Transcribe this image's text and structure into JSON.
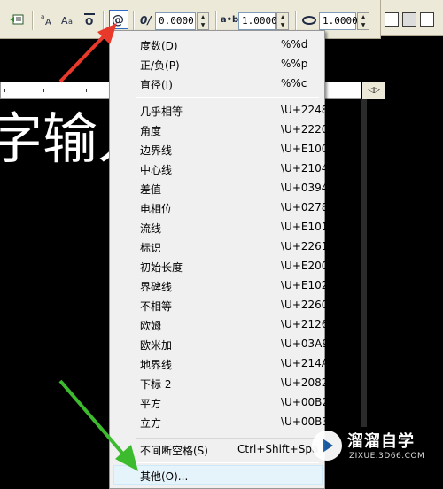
{
  "toolbar": {
    "icons": [
      "text-insert-icon",
      "stack-fraction-icon",
      "match-text-icon",
      "overline-icon",
      "symbol-icon"
    ],
    "oblique": {
      "value": "0.0000"
    },
    "tracking": {
      "label": "a•b",
      "value": "1.0000"
    },
    "width_factor": {
      "value": "1.0000"
    }
  },
  "ruler": {
    "arrows": "◁▷"
  },
  "editor": {
    "text": "字输入"
  },
  "menu": {
    "group1": [
      {
        "label": "度数(D)",
        "code": "%%d"
      },
      {
        "label": "正/负(P)",
        "code": "%%p"
      },
      {
        "label": "直径(I)",
        "code": "%%c"
      }
    ],
    "group2": [
      {
        "label": "几乎相等",
        "code": "\\U+2248"
      },
      {
        "label": "角度",
        "code": "\\U+2220"
      },
      {
        "label": "边界线",
        "code": "\\U+E100"
      },
      {
        "label": "中心线",
        "code": "\\U+2104"
      },
      {
        "label": "差值",
        "code": "\\U+0394"
      },
      {
        "label": "电相位",
        "code": "\\U+0278"
      },
      {
        "label": "流线",
        "code": "\\U+E101"
      },
      {
        "label": "标识",
        "code": "\\U+2261"
      },
      {
        "label": "初始长度",
        "code": "\\U+E200"
      },
      {
        "label": "界碑线",
        "code": "\\U+E102"
      },
      {
        "label": "不相等",
        "code": "\\U+2260"
      },
      {
        "label": "欧姆",
        "code": "\\U+2126"
      },
      {
        "label": "欧米加",
        "code": "\\U+03A9"
      },
      {
        "label": "地界线",
        "code": "\\U+214A"
      },
      {
        "label": "下标 2",
        "code": "\\U+2082"
      },
      {
        "label": "平方",
        "code": "\\U+00B2"
      },
      {
        "label": "立方",
        "code": "\\U+00B3"
      }
    ],
    "nbsp": {
      "label": "不间断空格(S)",
      "code": "Ctrl+Shift+Spa"
    },
    "other": {
      "label": "其他(O)..."
    }
  },
  "watermark": {
    "title": "溜溜自学",
    "url": "ZIXUE.3D66.COM"
  },
  "colors": {
    "arrow_red": "#e8392b",
    "arrow_green": "#3dbb2e",
    "menu_bg": "#f0f0f0",
    "toolbar_bg": "#ece9d8"
  }
}
